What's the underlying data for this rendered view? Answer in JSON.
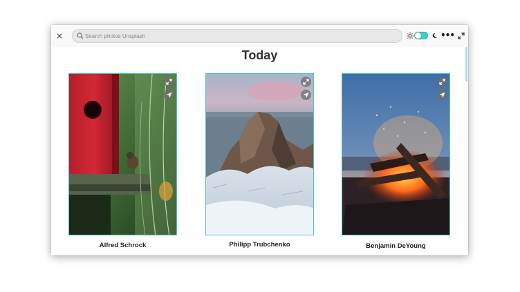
{
  "header": {
    "close_label": "×",
    "search_placeholder": "Search photos Unsplash",
    "menu_label": "•••"
  },
  "page": {
    "title": "Today"
  },
  "photos": [
    {
      "author": "Alfred Schrock"
    },
    {
      "author": "Philipp Trubchenko"
    },
    {
      "author": "Benjamin DeYoung"
    }
  ],
  "colors": {
    "accent": "#3ad0c8",
    "card_border": "#4fc0d0"
  }
}
